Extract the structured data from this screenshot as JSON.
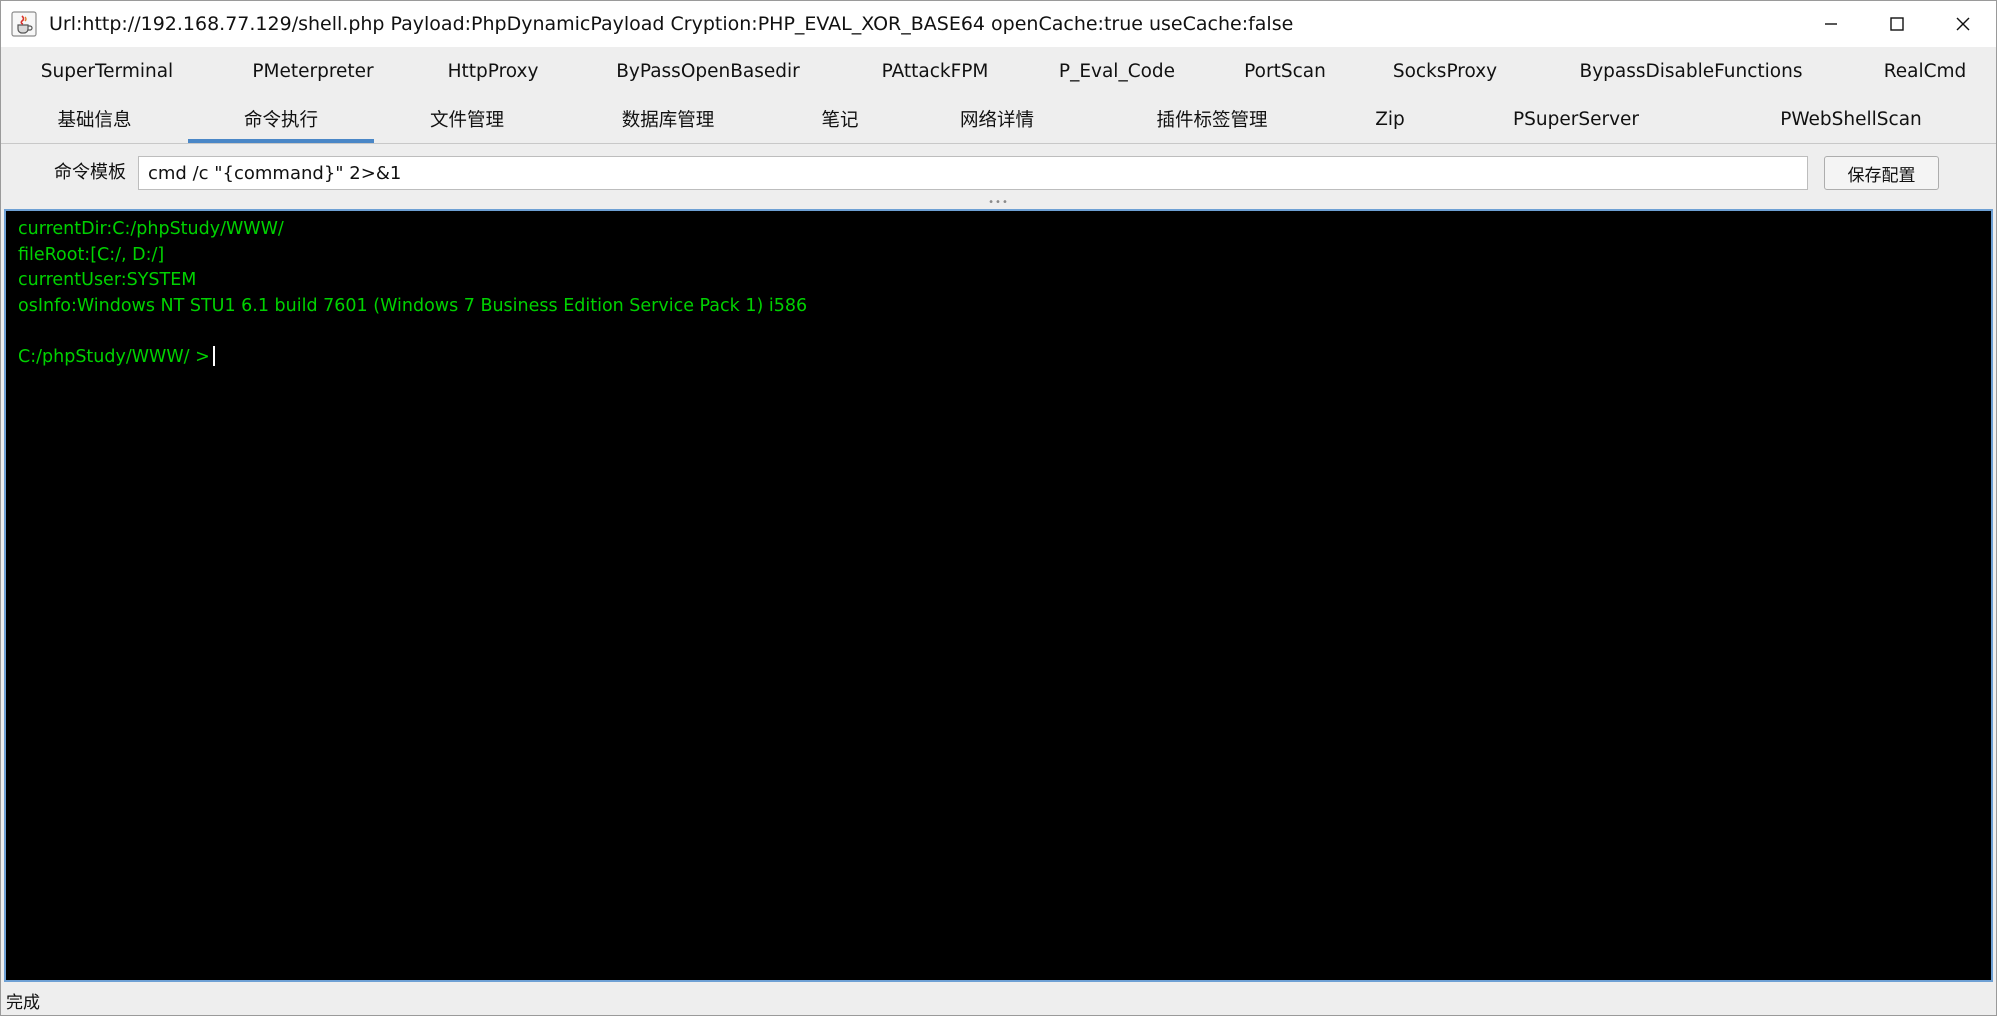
{
  "window": {
    "title": "Url:http://192.168.77.129/shell.php Payload:PhpDynamicPayload Cryption:PHP_EVAL_XOR_BASE64 openCache:true useCache:false",
    "icon": "java-cup-icon",
    "controls": [
      "minimize-icon",
      "maximize-icon",
      "close-icon"
    ]
  },
  "tabs_row1": [
    {
      "label": "SuperTerminal"
    },
    {
      "label": "PMeterpreter"
    },
    {
      "label": "HttpProxy"
    },
    {
      "label": "ByPassOpenBasedir"
    },
    {
      "label": "PAttackFPM"
    },
    {
      "label": "P_Eval_Code"
    },
    {
      "label": "PortScan"
    },
    {
      "label": "SocksProxy"
    },
    {
      "label": "BypassDisableFunctions"
    },
    {
      "label": "RealCmd"
    }
  ],
  "tabs_row2": [
    {
      "label": "基础信息"
    },
    {
      "label": "命令执行",
      "active": true
    },
    {
      "label": "文件管理"
    },
    {
      "label": "数据库管理"
    },
    {
      "label": "笔记"
    },
    {
      "label": "网络详情"
    },
    {
      "label": "插件标签管理"
    },
    {
      "label": "Zip"
    },
    {
      "label": "PSuperServer"
    },
    {
      "label": "PWebShellScan"
    }
  ],
  "command": {
    "label": "命令模板",
    "template": "cmd /c \"{command}\" 2>&1",
    "save_label": "保存配置"
  },
  "terminal": {
    "text_color": "#00d200",
    "background": "#000000",
    "lines": [
      "currentDir:C:/phpStudy/WWW/",
      "fileRoot:[C:/, D:/]",
      "currentUser:SYSTEM",
      "osInfo:Windows NT STU1 6.1 build 7601 (Windows 7 Business Edition Service Pack 1) i586",
      "",
      "C:/phpStudy/WWW/ >"
    ]
  },
  "status": {
    "text": "完成"
  },
  "colors": {
    "accent": "#4a87c7",
    "terminal_border": "#6ea0d4"
  }
}
